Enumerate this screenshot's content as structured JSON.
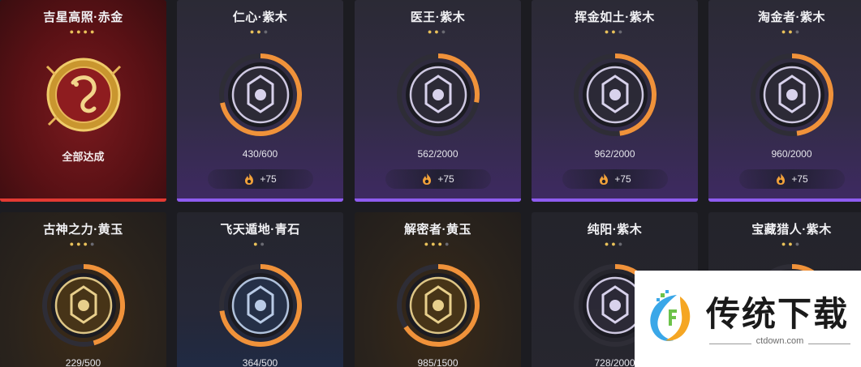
{
  "cards": [
    {
      "title": "吉星高照·赤金",
      "stars_on": 4,
      "stars_total": 4,
      "status": "全部达成",
      "theme": "red",
      "emblem": "dragon-emblem-icon"
    },
    {
      "title": "仁心·紫木",
      "stars_on": 2,
      "stars_total": 3,
      "progress": "430/600",
      "progress_ratio": 0.717,
      "reward": "+75",
      "theme": "purple",
      "emblem": "banner-emblem-icon"
    },
    {
      "title": "医王·紫木",
      "stars_on": 2,
      "stars_total": 3,
      "progress": "562/2000",
      "progress_ratio": 0.281,
      "reward": "+75",
      "theme": "purple",
      "emblem": "lotus-emblem-icon"
    },
    {
      "title": "挥金如土·紫木",
      "stars_on": 2,
      "stars_total": 3,
      "progress": "962/2000",
      "progress_ratio": 0.481,
      "reward": "+75",
      "theme": "purple",
      "emblem": "gems-emblem-icon"
    },
    {
      "title": "淘金者·紫木",
      "stars_on": 2,
      "stars_total": 3,
      "progress": "960/2000",
      "progress_ratio": 0.48,
      "reward": "+75",
      "theme": "purple",
      "emblem": "treasure-emblem-icon"
    },
    {
      "title": "古神之力·黄玉",
      "stars_on": 3,
      "stars_total": 4,
      "progress": "229/500",
      "progress_ratio": 0.458,
      "theme": "gold",
      "emblem": "serpent-emblem-icon"
    },
    {
      "title": "飞天遁地·青石",
      "stars_on": 1,
      "stars_total": 2,
      "progress": "364/500",
      "progress_ratio": 0.728,
      "theme": "blue",
      "emblem": "trident-emblem-icon"
    },
    {
      "title": "解密者·黄玉",
      "stars_on": 3,
      "stars_total": 4,
      "progress": "985/1500",
      "progress_ratio": 0.657,
      "theme": "gold",
      "emblem": "altar-emblem-icon"
    },
    {
      "title": "纯阳·紫木",
      "stars_on": 2,
      "stars_total": 3,
      "progress": "728/2000",
      "progress_ratio": 0.364,
      "theme": "dark",
      "emblem": "sun-emblem-icon"
    },
    {
      "title": "宝藏猎人·紫木",
      "stars_on": 2,
      "stars_total": 3,
      "progress_ratio": 0.2,
      "theme": "dark",
      "emblem": "hunter-emblem-icon"
    }
  ],
  "reward_icon": "flame-coin-icon",
  "colors": {
    "progress_arc": "#f0923a",
    "star_on": "#e9c15a",
    "red_accent": "#e23a33",
    "purple_accent": "#8e5cf0"
  },
  "watermark": {
    "title": "传统下载",
    "url": "ctdown.com"
  }
}
